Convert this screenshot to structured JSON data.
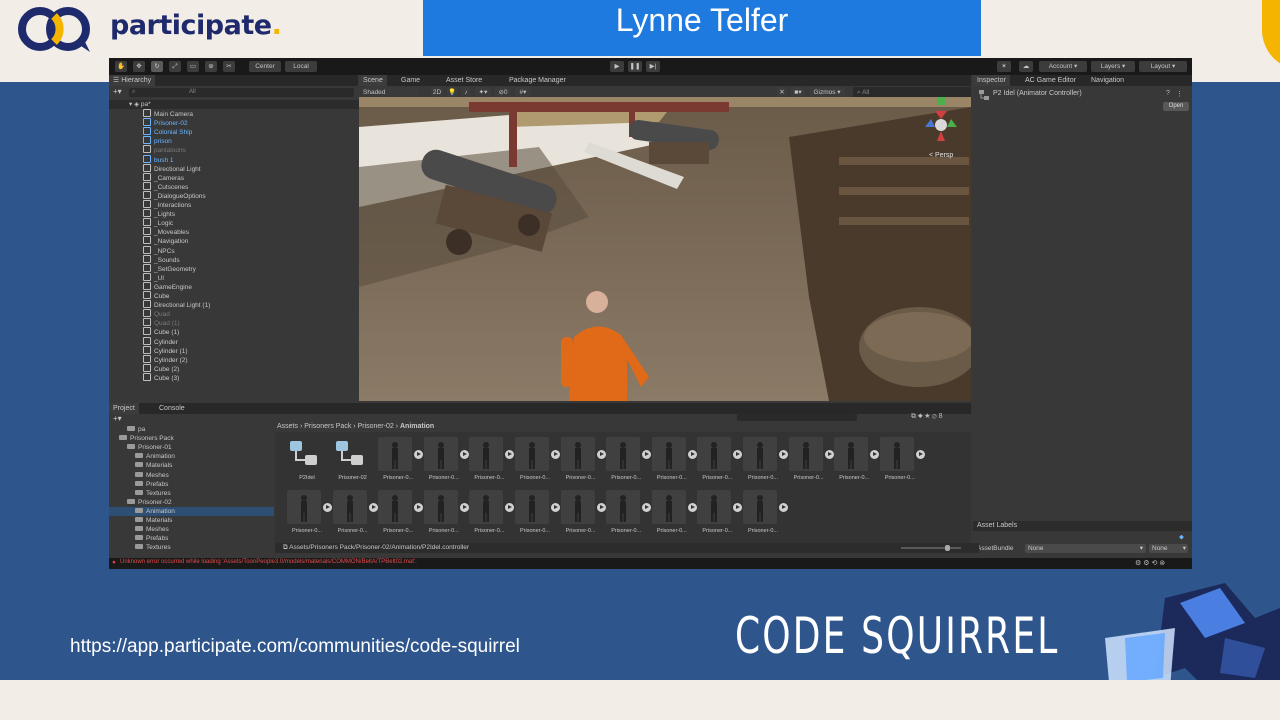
{
  "brand": {
    "name": "participate",
    "dot": ".",
    "accent": "#f5b400",
    "navy": "#1e2a6b"
  },
  "speaker": {
    "name": "Lynne Telfer",
    "bg": "#1f7ae0"
  },
  "footer": {
    "url": "https://app.participate.com/communities/code-squirrel",
    "wordmark": "CODE SQUIRREL"
  },
  "unity": {
    "toolbar": {
      "center": "Center",
      "local": "Local",
      "account": "Account",
      "layers": "Layers",
      "layout": "Layout"
    },
    "hierarchy": {
      "tab": "Hierarchy",
      "search_placeholder": "All",
      "scene": "pa*",
      "items": [
        {
          "label": "Main Camera",
          "style": ""
        },
        {
          "label": "Prisoner-02",
          "style": "blue"
        },
        {
          "label": "Colonial Ship",
          "style": "blue"
        },
        {
          "label": "prison",
          "style": "blue"
        },
        {
          "label": "pantaloons",
          "style": "dim"
        },
        {
          "label": "bush 1",
          "style": "blue"
        },
        {
          "label": "Directional Light",
          "style": ""
        },
        {
          "label": "_Cameras",
          "style": ""
        },
        {
          "label": "_Cutscenes",
          "style": ""
        },
        {
          "label": "_DialogueOptions",
          "style": ""
        },
        {
          "label": "_Interactions",
          "style": ""
        },
        {
          "label": "_Lights",
          "style": ""
        },
        {
          "label": "_Logic",
          "style": ""
        },
        {
          "label": "_Moveables",
          "style": ""
        },
        {
          "label": "_Navigation",
          "style": ""
        },
        {
          "label": "_NPCs",
          "style": ""
        },
        {
          "label": "_Sounds",
          "style": ""
        },
        {
          "label": "_SetGeometry",
          "style": ""
        },
        {
          "label": "_UI",
          "style": ""
        },
        {
          "label": "GameEngine",
          "style": ""
        },
        {
          "label": "Cube",
          "style": ""
        },
        {
          "label": "Directional Light (1)",
          "style": ""
        },
        {
          "label": "Quad",
          "style": "dim"
        },
        {
          "label": "Quad (1)",
          "style": "dim"
        },
        {
          "label": "Cube (1)",
          "style": ""
        },
        {
          "label": "Cylinder",
          "style": ""
        },
        {
          "label": "Cylinder (1)",
          "style": ""
        },
        {
          "label": "Cylinder (2)",
          "style": ""
        },
        {
          "label": "Cube (2)",
          "style": ""
        },
        {
          "label": "Cube (3)",
          "style": ""
        }
      ]
    },
    "scene": {
      "tabs": [
        "Scene",
        "Game",
        "Asset Store",
        "Package Manager"
      ],
      "shading": "Shaded",
      "mode2d": "2D",
      "gizmos": "Gizmos",
      "search_placeholder": "All",
      "persp": "< Persp"
    },
    "inspector": {
      "tabs": [
        "Inspector",
        "AC Game Editor",
        "Navigation"
      ],
      "object": "P2 Idel (Animator Controller)",
      "open": "Open",
      "asset_labels": "Asset Labels",
      "asset_bundle": "AssetBundle",
      "bundle_value": "None",
      "variant_value": "None"
    },
    "project": {
      "tabs": [
        "Project",
        "Console"
      ],
      "tree": [
        {
          "label": "pa",
          "sel": false
        },
        {
          "label": "Prisoners Pack",
          "sel": false
        },
        {
          "label": "Prisoner-01",
          "sel": false
        },
        {
          "label": "Animation",
          "sel": false
        },
        {
          "label": "Materials",
          "sel": false
        },
        {
          "label": "Meshes",
          "sel": false
        },
        {
          "label": "Prefabs",
          "sel": false
        },
        {
          "label": "Textures",
          "sel": false
        },
        {
          "label": "Prisoner-02",
          "sel": false
        },
        {
          "label": "Animation",
          "sel": true
        },
        {
          "label": "Materials",
          "sel": false
        },
        {
          "label": "Meshes",
          "sel": false
        },
        {
          "label": "Prefabs",
          "sel": false
        },
        {
          "label": "Textures",
          "sel": false
        }
      ],
      "breadcrumb": [
        "Assets",
        "Prisoners Pack",
        "Prisoner-02",
        "Animation"
      ],
      "assets_row1": [
        "P2Idel",
        "Prisoner-02",
        "Prisoner-0...",
        "Prisoner-0...",
        "Prisoner-0...",
        "Prisoner-0...",
        "Prisoner-0...",
        "Prisoner-0...",
        "Prisoner-0...",
        "Prisoner-0...",
        "Prisoner-0...",
        "Prisoner-0...",
        "Prisoner-0...",
        "Prisoner-0..."
      ],
      "assets_row2": [
        "Prisoner-0...",
        "Prisoner-0...",
        "Prisoner-0...",
        "Prisoner-0...",
        "Prisoner-0...",
        "Prisoner-0...",
        "Prisoner-0...",
        "Prisoner-0...",
        "Prisoner-0...",
        "Prisoner-0...",
        "Prisoner-0..."
      ],
      "path": "Assets/Prisoners Pack/Prisoner-02/Animation/P2Idel.controller"
    },
    "status": "Unknown error occurred while loading 'Assets/ToonPeople3.0/models/materials/COMMON/BeltA/TPBelt02.mat'."
  }
}
